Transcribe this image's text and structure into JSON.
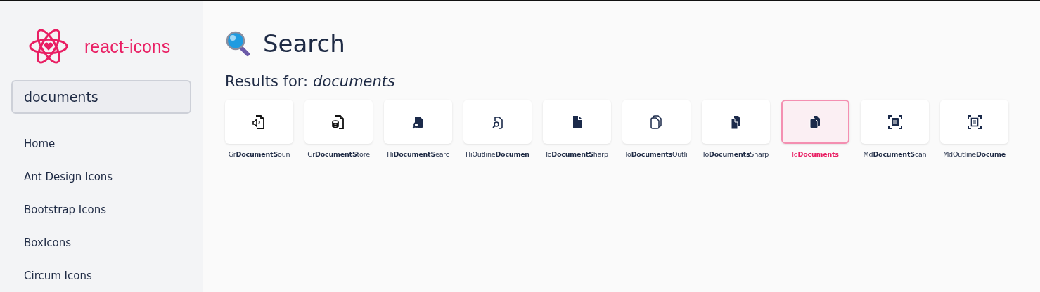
{
  "sidebar": {
    "logo_text": "react-icons",
    "search": {
      "value": "documents"
    },
    "items": [
      {
        "label": "Home",
        "selected": false
      },
      {
        "label": "Ant Design Icons",
        "selected": false
      },
      {
        "label": "Bootstrap Icons",
        "selected": false
      },
      {
        "label": "BoxIcons",
        "selected": false
      },
      {
        "label": "Circum Icons",
        "selected": false
      }
    ]
  },
  "main": {
    "title": "Search",
    "results_label": "Results for:",
    "query": "documents",
    "results": [
      {
        "label": "Gr**DocumentS**oun",
        "selected": false
      },
      {
        "label": "Gr**DocumentS**tore",
        "selected": false
      },
      {
        "label": "Hi**DocumentS**earc",
        "selected": false
      },
      {
        "label": "HiOutline**Documen**",
        "selected": false
      },
      {
        "label": "Io**DocumentS**harp",
        "selected": false
      },
      {
        "label": "Io**Documents**Outli",
        "selected": false
      },
      {
        "label": "Io**Documents**Sharp",
        "selected": false
      },
      {
        "label": "Io**Documents**",
        "selected": true
      },
      {
        "label": "Md**DocumentS**can",
        "selected": false
      },
      {
        "label": "MdOutline**Docume**",
        "selected": false
      }
    ]
  }
}
